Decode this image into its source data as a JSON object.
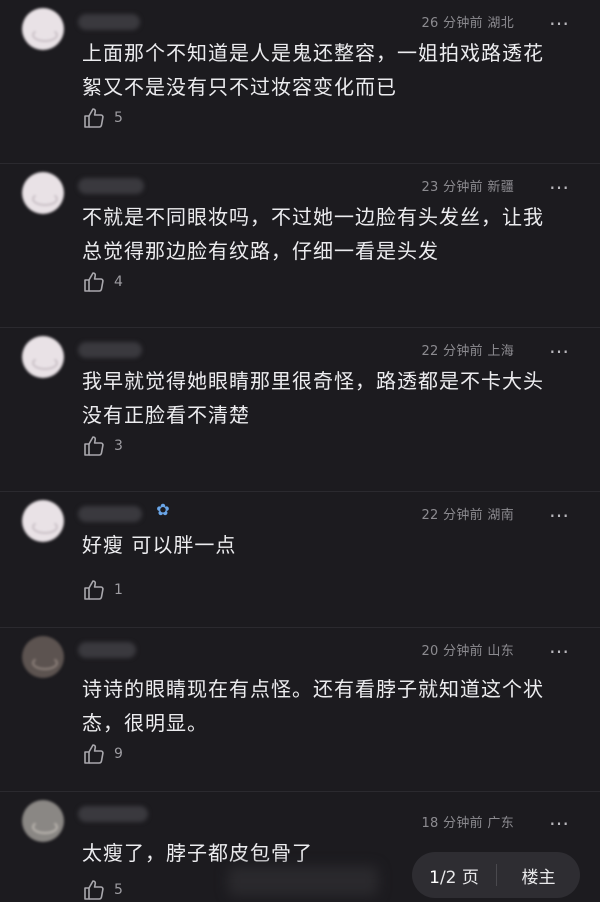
{
  "comments": [
    {
      "meta": "26 分钟前 湖北",
      "text_line1": "上面那个不知道是人是鬼还整容，一姐拍戏路透花",
      "text_line2": "絮又不是没有只不过妆容变化而已",
      "likes": "5"
    },
    {
      "meta": "23 分钟前 新疆",
      "text_line1": "不就是不同眼妆吗，不过她一边脸有头发丝，让我",
      "text_line2": "总觉得那边脸有纹路，仔细一看是头发",
      "likes": "4"
    },
    {
      "meta": "22 分钟前 上海",
      "text_line1": "我早就觉得她眼睛那里很奇怪，路透都是不卡大头",
      "text_line2": "没有正脸看不清楚",
      "likes": "3"
    },
    {
      "meta": "22 分钟前 湖南",
      "text_line1": "好瘦  可以胖一点",
      "text_line2": "",
      "likes": "1"
    },
    {
      "meta": "20 分钟前 山东",
      "text_line1": "诗诗的眼睛现在有点怪。还有看脖子就知道这个状",
      "text_line2": "态，很明显。",
      "likes": "9"
    },
    {
      "meta": "18 分钟前 广东",
      "text_line1": "太瘦了，脖子都皮包骨了",
      "text_line2": "",
      "likes": "5"
    }
  ],
  "more_icon": "…",
  "pager": {
    "current": "1",
    "total": "/2 页",
    "floor_button": "楼主"
  }
}
